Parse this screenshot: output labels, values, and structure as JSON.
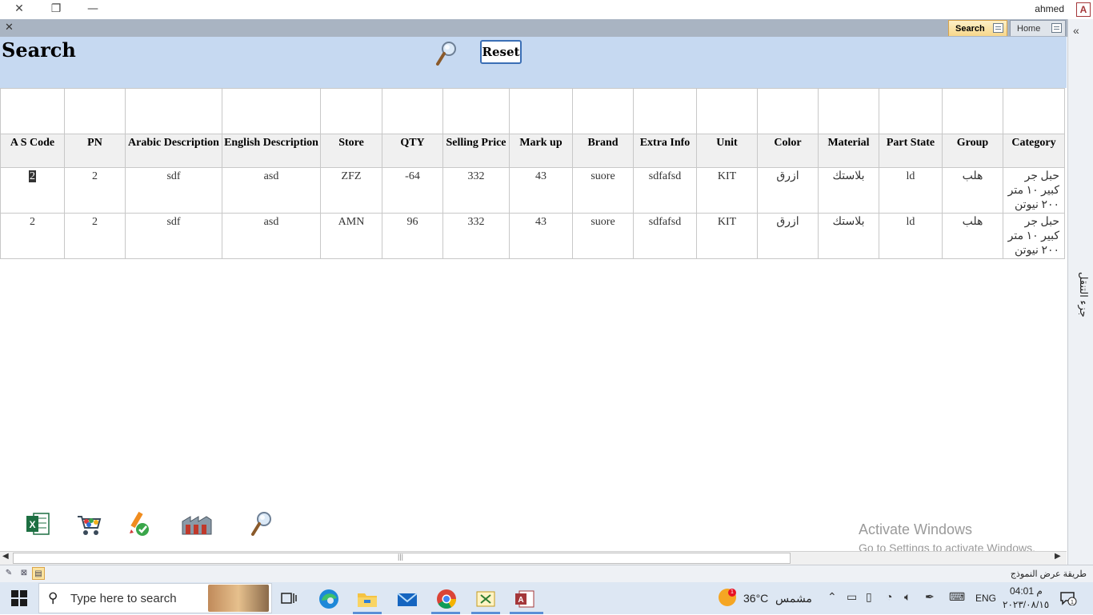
{
  "titlebar": {
    "close_glyph": "✕",
    "restore_glyph": "❐",
    "minimize_glyph": "—",
    "user": "ahmed",
    "app_badge": "A"
  },
  "tabs": {
    "close_glyph": "✕",
    "items": [
      {
        "label": "Search",
        "active": true
      },
      {
        "label": "Home",
        "active": false
      }
    ]
  },
  "nav_pane": {
    "chevron": "«",
    "label": "جزء التنقل"
  },
  "form": {
    "title": "Search",
    "reset_label": "Reset"
  },
  "grid": {
    "columns": [
      "A S Code",
      "PN",
      "Arabic Description",
      "English Description",
      "Store",
      "QTY",
      "Selling Price",
      "Mark up",
      "Brand",
      "Extra Info",
      "Unit",
      "Color",
      "Material",
      "Part State",
      "Group",
      "Category"
    ],
    "rows": [
      [
        "2",
        "2",
        "sdf",
        "asd",
        "ZFZ",
        "-64",
        "332",
        "43",
        "suore",
        "sdfafsd",
        "KIT",
        "ازرق",
        "بلاستك",
        "ld",
        "هلب",
        "حبل جر كبير ١٠ متر ٢٠٠ نيوتن"
      ],
      [
        "2",
        "2",
        "sdf",
        "asd",
        "AMN",
        "96",
        "332",
        "43",
        "suore",
        "sdfafsd",
        "KIT",
        "ازرق",
        "بلاستك",
        "ld",
        "هلب",
        "حبل جر كبير ١٠ متر ٢٠٠ نيوتن"
      ]
    ]
  },
  "footer_icons": [
    "excel-export-icon",
    "cart-icon",
    "edit-check-icon",
    "warehouse-icon",
    "search-icon"
  ],
  "watermark": {
    "line1": "Activate Windows",
    "line2": "Go to Settings to activate Windows."
  },
  "statusbar": {
    "text": "طريقة عرض النموذج"
  },
  "taskbar": {
    "search_placeholder": "Type here to search",
    "temperature": "36°C",
    "weather": "مشمس",
    "weather_badge": "1",
    "language": "ENG",
    "time": "04:01 م",
    "date": "٢٠٢٣/٠٨/١٥",
    "notification_count": "1"
  }
}
